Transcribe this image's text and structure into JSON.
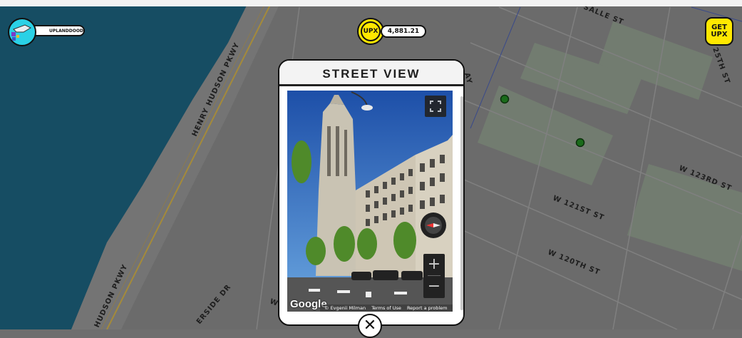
{
  "colors": {
    "water": "#164d63",
    "land": "#6b6b6b",
    "park": "#727c70",
    "marker": "#1a6b1a",
    "upx_yellow": "#ffe800"
  },
  "map": {
    "street_labels": {
      "henry_hudson_north": "HENRY HUDSON PKWY",
      "henry_hudson_south": "HUDSON PKWY",
      "riverside": "ERSIDE DR",
      "w121": "W 121ST ST",
      "w120": "W 120TH ST",
      "w123": "W 123RD ST",
      "la_salle": "SALLE ST",
      "c125": "25TH ST",
      "ay": "AY",
      "w_fragment": "W"
    },
    "markers": [
      {
        "name": "property-marker-1",
        "icon": "green-dot"
      },
      {
        "name": "property-marker-2",
        "icon": "green-dot"
      }
    ]
  },
  "user": {
    "name": "UPLANDDOOD",
    "avatar_icon": "avatar-icon"
  },
  "balance": {
    "coin_label": "UPX",
    "amount": "4,881.21"
  },
  "get_upx": {
    "line1": "GET",
    "line2": "UPX"
  },
  "modal": {
    "title": "STREET VIEW",
    "streetview": {
      "google_logo": "Google",
      "attribution": "© Evgenii Milman",
      "terms": "Terms of Use",
      "report": "Report a problem",
      "zoom_in": "+",
      "zoom_out": "−"
    },
    "close_label": "✕"
  }
}
